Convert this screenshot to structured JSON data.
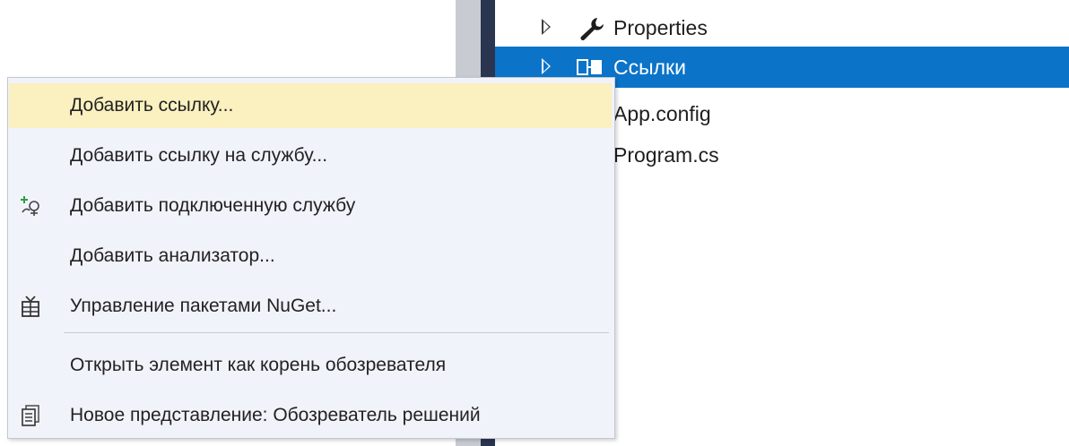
{
  "solution_explorer": {
    "items": [
      {
        "label": "Properties",
        "icon": "wrench-icon",
        "expandable": true,
        "selected": false
      },
      {
        "label": "Ссылки",
        "icon": "references-icon",
        "expandable": true,
        "selected": true
      },
      {
        "label": "App.config",
        "icon": "",
        "expandable": false,
        "selected": false
      },
      {
        "label": "Program.cs",
        "icon": "",
        "expandable": false,
        "selected": false
      }
    ]
  },
  "context_menu": {
    "items": [
      {
        "label": "Добавить ссылку...",
        "icon": "",
        "highlighted": true
      },
      {
        "label": "Добавить ссылку на службу...",
        "icon": ""
      },
      {
        "label": "Добавить подключенную службу",
        "icon": "add-connected-service-icon"
      },
      {
        "label": "Добавить анализатор...",
        "icon": ""
      },
      {
        "label": "Управление пакетами NuGet...",
        "icon": "nuget-package-icon"
      },
      {
        "label": "Открыть элемент как корень обозревателя",
        "icon": ""
      },
      {
        "label": "Новое представление: Обозреватель решений",
        "icon": "new-view-icon"
      }
    ]
  },
  "colors": {
    "selection": "#0b74c9",
    "menu_background": "#f1f3fa",
    "menu_highlight": "#fbf0bf",
    "gutter_dark": "#2a3550"
  }
}
